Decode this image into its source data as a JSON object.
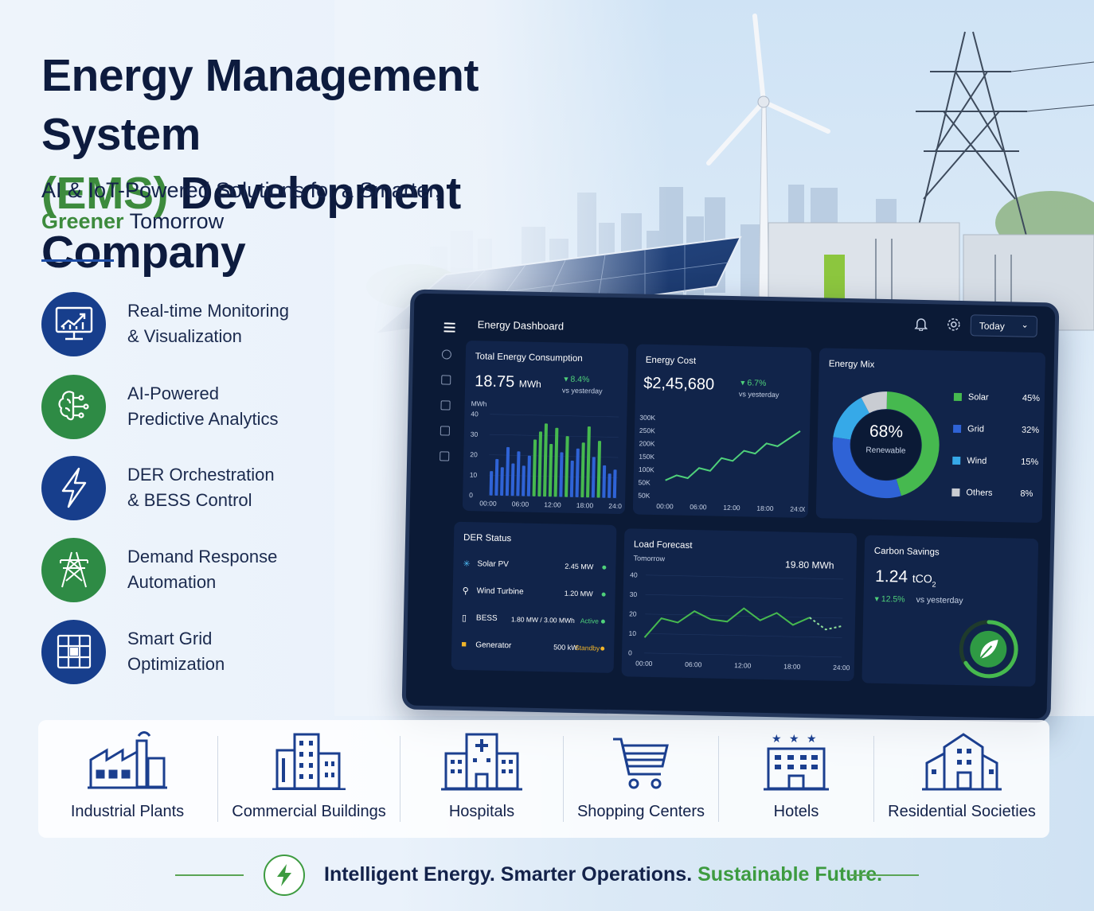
{
  "header": {
    "title_line1": "Energy Management System",
    "title_line2_green": "(EMS)",
    "title_line2_rest": "Development Company",
    "subtitle_line1": "AI & IoT-Powered Solutions for a Smarter,",
    "subtitle_green": "Greener",
    "subtitle_rest": "Tomorrow"
  },
  "features": [
    {
      "line1": "Real-time Monitoring",
      "line2": "& Visualization",
      "icon": "monitor-chart-icon"
    },
    {
      "line1": "AI-Powered",
      "line2": "Predictive Analytics",
      "icon": "brain-circuit-icon"
    },
    {
      "line1": "DER Orchestration",
      "line2": "& BESS Control",
      "icon": "lightning-bolt-icon"
    },
    {
      "line1": "Demand Response",
      "line2": "Automation",
      "icon": "power-tower-icon"
    },
    {
      "line1": "Smart Grid",
      "line2": "Optimization",
      "icon": "grid-panel-icon"
    }
  ],
  "dashboard": {
    "title": "Energy Dashboard",
    "period": "Today",
    "consumption": {
      "title": "Total Energy Consumption",
      "value": "18.75",
      "unit": "MWh",
      "delta": "8.4%",
      "delta_note": "vs yesterday",
      "y_unit": "MWh",
      "y_ticks": [
        "40",
        "30",
        "20",
        "10",
        "0"
      ],
      "x_ticks": [
        "00:00",
        "06:00",
        "12:00",
        "18:00",
        "24:00"
      ]
    },
    "cost": {
      "title": "Energy Cost",
      "value": "$2,45,680",
      "delta": "6.7%",
      "delta_note": "vs yesterday",
      "y_ticks": [
        "300K",
        "250K",
        "200K",
        "150K",
        "100K",
        "50K",
        "50K"
      ],
      "x_ticks": [
        "00:00",
        "06:00",
        "12:00",
        "18:00",
        "24:00"
      ]
    },
    "mix": {
      "title": "Energy Mix",
      "center_value": "68%",
      "center_label": "Renewable",
      "items": [
        {
          "name": "Solar",
          "pct": "45%",
          "color": "#46b94f"
        },
        {
          "name": "Grid",
          "pct": "32%",
          "color": "#2f63d6"
        },
        {
          "name": "Wind",
          "pct": "15%",
          "color": "#36a9e8"
        },
        {
          "name": "Others",
          "pct": "8%",
          "color": "#c9ccd2"
        }
      ]
    },
    "der": {
      "title": "DER Status",
      "rows": [
        {
          "name": "Solar PV",
          "value": "2.45 MW",
          "state": "",
          "icon": "sun-icon"
        },
        {
          "name": "Wind Turbine",
          "value": "1.20 MW",
          "state": "",
          "icon": "wind-turbine-icon"
        },
        {
          "name": "BESS",
          "value": "1.80 MW / 3.00 MWh",
          "state": "Active",
          "icon": "battery-icon"
        },
        {
          "name": "Generator",
          "value": "500 kW",
          "state": "Standby",
          "icon": "generator-icon"
        }
      ]
    },
    "forecast": {
      "title": "Load Forecast",
      "subtitle": "Tomorrow",
      "value": "19.80 MWh",
      "y_ticks": [
        "40",
        "30",
        "20",
        "10",
        "0"
      ],
      "x_ticks": [
        "00:00",
        "06:00",
        "12:00",
        "18:00",
        "24:00"
      ]
    },
    "carbon": {
      "title": "Carbon Savings",
      "value": "1.24",
      "unit": "tCO",
      "unit_sub": "2",
      "delta": "12.5%",
      "delta_note": "vs yesterday"
    }
  },
  "chart_data": [
    {
      "type": "bar",
      "title": "Total Energy Consumption",
      "ylabel": "MWh",
      "ylim": [
        0,
        40
      ],
      "x": [
        "00:00",
        "01:00",
        "02:00",
        "03:00",
        "04:00",
        "05:00",
        "06:00",
        "07:00",
        "08:00",
        "09:00",
        "10:00",
        "11:00",
        "12:00",
        "13:00",
        "14:00",
        "15:00",
        "16:00",
        "17:00",
        "18:00",
        "19:00",
        "20:00",
        "21:00",
        "22:00",
        "23:00"
      ],
      "values": [
        12,
        18,
        14,
        24,
        16,
        22,
        15,
        20,
        28,
        32,
        36,
        26,
        34,
        22,
        30,
        18,
        24,
        27,
        35,
        20,
        28,
        16,
        12,
        14
      ]
    },
    {
      "type": "line",
      "title": "Energy Cost",
      "ylim": [
        0,
        300000
      ],
      "x": [
        0,
        2,
        4,
        6,
        8,
        10,
        12,
        14,
        16,
        18,
        20,
        22,
        24
      ],
      "values": [
        60000,
        80000,
        70000,
        110000,
        100000,
        150000,
        140000,
        180000,
        170000,
        210000,
        200000,
        230000,
        260000
      ]
    },
    {
      "type": "pie",
      "title": "Energy Mix",
      "categories": [
        "Solar",
        "Grid",
        "Wind",
        "Others"
      ],
      "values": [
        45,
        32,
        15,
        8
      ]
    },
    {
      "type": "line",
      "title": "Load Forecast",
      "ylim": [
        0,
        40
      ],
      "x": [
        0,
        2,
        4,
        6,
        8,
        10,
        12,
        14,
        16,
        18,
        20,
        22,
        24
      ],
      "values": [
        8,
        18,
        16,
        22,
        18,
        17,
        24,
        18,
        22,
        16,
        20,
        14,
        16
      ],
      "forecast_from_index": 10
    }
  ],
  "industries": [
    {
      "label": "Industrial Plants",
      "icon": "factory-icon"
    },
    {
      "label": "Commercial Buildings",
      "icon": "office-building-icon"
    },
    {
      "label": "Hospitals",
      "icon": "hospital-icon"
    },
    {
      "label": "Shopping Centers",
      "icon": "shopping-cart-icon"
    },
    {
      "label": "Hotels",
      "icon": "hotel-icon"
    },
    {
      "label": "Residential Societies",
      "icon": "residential-icon"
    }
  ],
  "tagline": {
    "part1": "Intelligent Energy. Smarter Operations.",
    "part2": "Sustainable Future."
  },
  "colors": {
    "navy": "#0d1b3e",
    "green": "#3d8b3d",
    "accent_blue": "#1f4fa8",
    "dash_bg": "#0b1a36"
  }
}
